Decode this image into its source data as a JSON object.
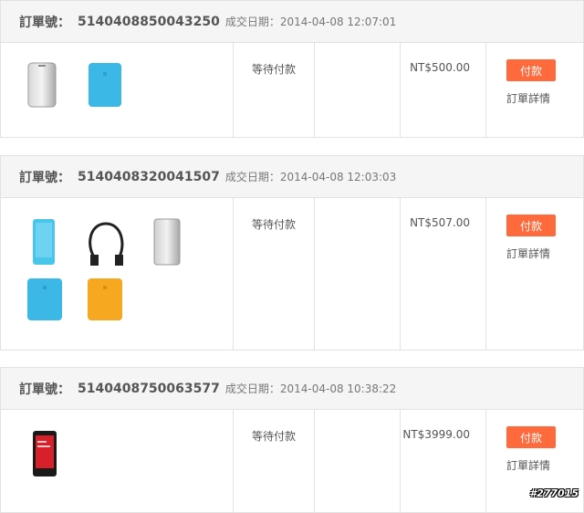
{
  "orders": [
    {
      "order_label": "訂單號：",
      "order_number": "5140408850043250",
      "date_text": "成交日期：2014-04-08 12:07:01",
      "status": "等待付款",
      "price": "NT$500.00",
      "pay_label": "付款",
      "detail_label": "訂單詳情",
      "products": [
        "silver-power-bank",
        "blue-power-bank"
      ]
    },
    {
      "order_label": "訂單號：",
      "order_number": "5140408320041507",
      "date_text": "成交日期：2014-04-08 12:03:03",
      "status": "等待付款",
      "price": "NT$507.00",
      "pay_label": "付款",
      "detail_label": "訂單詳情",
      "products": [
        "blue-phone-case",
        "usb-cable",
        "silver-power-bank",
        "blue-power-bank",
        "orange-power-bank"
      ]
    },
    {
      "order_label": "訂單號：",
      "order_number": "5140408750063577",
      "date_text": "成交日期：2014-04-08 10:38:22",
      "status": "等待付款",
      "price": "NT$3999.00",
      "pay_label": "付款",
      "detail_label": "訂單詳情",
      "products": [
        "red-phone"
      ]
    }
  ],
  "watermark": "#277015",
  "colors": {
    "pay_button": "#ff6a3c",
    "header_bg": "#f5f5f5",
    "border": "#e2e2e2"
  }
}
